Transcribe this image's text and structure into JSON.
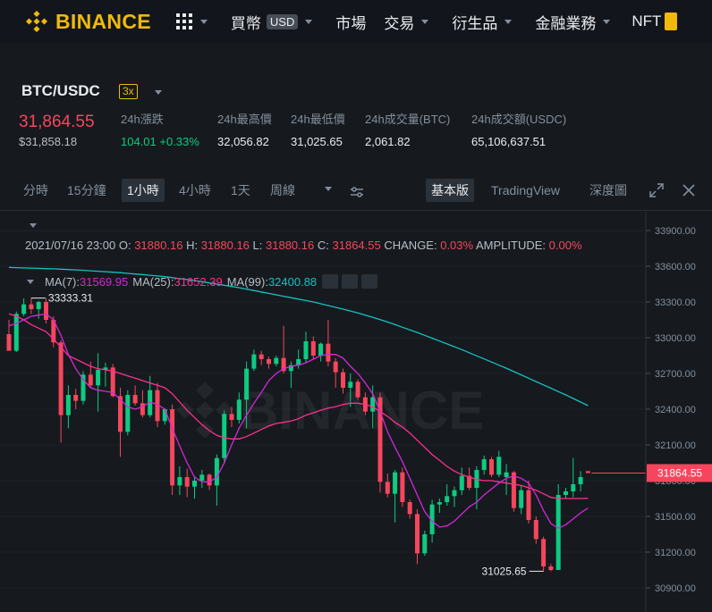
{
  "brand": {
    "name": "BINANCE",
    "color": "#f0b90b"
  },
  "nav": {
    "grid_icon": "grid-icon",
    "items": [
      {
        "label": "買幣",
        "badge": "USD"
      },
      {
        "label": "市場"
      },
      {
        "label": "交易"
      },
      {
        "label": "衍生品"
      },
      {
        "label": "金融業務"
      },
      {
        "label": "NFT"
      }
    ]
  },
  "pair": {
    "symbol": "BTC/USDC",
    "leverage": "3x",
    "last_price": "31,864.55",
    "last_price_usd": "$31,858.18",
    "stats": [
      {
        "label": "24h漲跌",
        "value": "104.01 +0.33%"
      },
      {
        "label": "24h最高價",
        "value": "32,056.82"
      },
      {
        "label": "24h最低價",
        "value": "31,025.65"
      },
      {
        "label": "24h成交量(BTC)",
        "value": "2,061.82"
      },
      {
        "label": "24h成交額(USDC)",
        "value": "65,106,637.51"
      }
    ]
  },
  "toolbar": {
    "intervals": [
      "分時",
      "15分鐘",
      "1小時",
      "4小時",
      "1天",
      "周線"
    ],
    "active_interval": "1小時",
    "views": [
      "基本版",
      "TradingView",
      "深度圖"
    ],
    "active_view": "基本版"
  },
  "ohlc": {
    "date": "2021/07/16 23:00",
    "o_label": "O:",
    "o": "31880.16",
    "h_label": "H:",
    "h": "31880.16",
    "l_label": "L:",
    "l": "31880.16",
    "c_label": "C:",
    "c": "31864.55",
    "change_label": "CHANGE:",
    "change": "0.03%",
    "amp_label": "AMPLITUDE:",
    "amplitude": "0.00%"
  },
  "ma": {
    "ma7_label": "MA(7):",
    "ma7": "31569.95",
    "ma25_label": "MA(25):",
    "ma25": "31652.39",
    "ma99_label": "MA(99):",
    "ma99": "32400.88"
  },
  "colors": {
    "up": "#0ecb81",
    "down": "#f6465d",
    "ma7": "#d427d9",
    "ma25": "#ff2f8f",
    "ma99": "#14c2c2",
    "bg": "#161a1e"
  },
  "chart_data": {
    "type": "candlestick",
    "y_ticks": [
      "33900.00",
      "33600.00",
      "33300.00",
      "33000.00",
      "32700.00",
      "32400.00",
      "32100.00",
      "31800.00",
      "31500.00",
      "31200.00",
      "30900.00"
    ],
    "ylim": [
      30800,
      34000
    ],
    "current_price_label": "31864.55",
    "high_marker": "33333.31",
    "low_marker": "31025.65",
    "watermark": "BINANCE",
    "candles_ohlc": [
      [
        33030,
        33150,
        32890,
        32890
      ],
      [
        32890,
        33220,
        32880,
        33200
      ],
      [
        33200,
        33330,
        33180,
        33280
      ],
      [
        33280,
        33333,
        33200,
        33240
      ],
      [
        33240,
        33310,
        33160,
        33300
      ],
      [
        33300,
        33330,
        33120,
        33150
      ],
      [
        33150,
        33180,
        32920,
        32960
      ],
      [
        32960,
        32980,
        32120,
        32350
      ],
      [
        32350,
        32600,
        32240,
        32520
      ],
      [
        32520,
        32570,
        32400,
        32470
      ],
      [
        32470,
        32720,
        32440,
        32690
      ],
      [
        32690,
        32800,
        32580,
        32600
      ],
      [
        32600,
        32870,
        32380,
        32730
      ],
      [
        32730,
        32790,
        32590,
        32750
      ],
      [
        32750,
        32780,
        32500,
        32510
      ],
      [
        32510,
        32580,
        32000,
        32210
      ],
      [
        32210,
        32560,
        32180,
        32520
      ],
      [
        32520,
        32600,
        32430,
        32450
      ],
      [
        32450,
        32560,
        32330,
        32350
      ],
      [
        32350,
        32680,
        32330,
        32560
      ],
      [
        32560,
        32620,
        32250,
        32300
      ],
      [
        32300,
        32410,
        32270,
        32400
      ],
      [
        32400,
        32440,
        31680,
        31760
      ],
      [
        31760,
        31920,
        31680,
        31830
      ],
      [
        31830,
        31900,
        31660,
        31750
      ],
      [
        31750,
        31840,
        31650,
        31800
      ],
      [
        31800,
        31890,
        31740,
        31850
      ],
      [
        31850,
        31860,
        31720,
        31760
      ],
      [
        31760,
        32020,
        31590,
        31990
      ],
      [
        31990,
        32390,
        31940,
        32360
      ],
      [
        32360,
        32420,
        32250,
        32310
      ],
      [
        32310,
        32540,
        32280,
        32480
      ],
      [
        32480,
        32800,
        32240,
        32740
      ],
      [
        32740,
        32900,
        32720,
        32860
      ],
      [
        32860,
        32890,
        32770,
        32820
      ],
      [
        32820,
        32840,
        32740,
        32780
      ],
      [
        32780,
        32850,
        32760,
        32830
      ],
      [
        32830,
        33100,
        32700,
        32720
      ],
      [
        32720,
        32800,
        32580,
        32770
      ],
      [
        32770,
        32900,
        32740,
        32820
      ],
      [
        32820,
        33050,
        32790,
        32970
      ],
      [
        32970,
        33010,
        32820,
        32850
      ],
      [
        32850,
        32960,
        32800,
        32950
      ],
      [
        32950,
        33150,
        32760,
        32800
      ],
      [
        32800,
        32830,
        32580,
        32710
      ],
      [
        32710,
        32740,
        32530,
        32580
      ],
      [
        32580,
        32700,
        32420,
        32630
      ],
      [
        32630,
        32650,
        32480,
        32500
      ],
      [
        32500,
        32540,
        32350,
        32380
      ],
      [
        32380,
        32600,
        32240,
        32500
      ],
      [
        32500,
        32540,
        31700,
        31790
      ],
      [
        31790,
        31860,
        31660,
        31690
      ],
      [
        31690,
        31890,
        31450,
        31870
      ],
      [
        31870,
        31910,
        31580,
        31620
      ],
      [
        31620,
        31640,
        31480,
        31520
      ],
      [
        31520,
        31560,
        31100,
        31190
      ],
      [
        31190,
        31380,
        31170,
        31350
      ],
      [
        31350,
        31640,
        31280,
        31600
      ],
      [
        31600,
        31650,
        31530,
        31620
      ],
      [
        31620,
        31770,
        31590,
        31670
      ],
      [
        31670,
        31750,
        31580,
        31720
      ],
      [
        31720,
        31910,
        31680,
        31840
      ],
      [
        31840,
        31910,
        31720,
        31740
      ],
      [
        31740,
        31920,
        31560,
        31890
      ],
      [
        31890,
        32010,
        31850,
        31980
      ],
      [
        31980,
        32000,
        31830,
        31850
      ],
      [
        31850,
        32050,
        31830,
        32000
      ],
      [
        31830,
        31940,
        31680,
        31870
      ],
      [
        31870,
        31880,
        31540,
        31570
      ],
      [
        31570,
        31760,
        31520,
        31720
      ],
      [
        31720,
        31800,
        31440,
        31470
      ],
      [
        31470,
        31500,
        31270,
        31310
      ],
      [
        31310,
        31330,
        31040,
        31080
      ],
      [
        31080,
        31100,
        31040,
        31050
      ],
      [
        31050,
        31770,
        31050,
        31680
      ],
      [
        31680,
        31740,
        31650,
        31710
      ],
      [
        31710,
        31990,
        31660,
        31770
      ],
      [
        31770,
        31880,
        31710,
        31830
      ],
      [
        31880,
        31880,
        31880,
        31864
      ]
    ],
    "ma7": [
      33100,
      33120,
      33150,
      33180,
      33190,
      33200,
      33150,
      33020,
      32860,
      32740,
      32650,
      32580,
      32560,
      32550,
      32540,
      32480,
      32420,
      32400,
      32420,
      32460,
      32440,
      32400,
      32240,
      32090,
      31950,
      31830,
      31790,
      31790,
      31830,
      31950,
      32100,
      32240,
      32350,
      32450,
      32540,
      32640,
      32700,
      32740,
      32760,
      32770,
      32790,
      32820,
      32850,
      32860,
      32860,
      32830,
      32760,
      32700,
      32620,
      32530,
      32380,
      32210,
      32080,
      31960,
      31820,
      31680,
      31540,
      31460,
      31410,
      31420,
      31460,
      31520,
      31580,
      31620,
      31680,
      31730,
      31780,
      31820,
      31840,
      31820,
      31780,
      31680,
      31550,
      31440,
      31400,
      31430,
      31480,
      31530,
      31570
    ],
    "ma25": [
      33200,
      33180,
      33150,
      33110,
      33080,
      33050,
      32990,
      32920,
      32850,
      32820,
      32790,
      32760,
      32740,
      32730,
      32720,
      32700,
      32680,
      32660,
      32640,
      32620,
      32600,
      32580,
      32530,
      32460,
      32390,
      32330,
      32270,
      32220,
      32180,
      32160,
      32150,
      32150,
      32170,
      32200,
      32230,
      32260,
      32280,
      32290,
      32300,
      32320,
      32350,
      32370,
      32390,
      32410,
      32420,
      32440,
      32450,
      32450,
      32440,
      32420,
      32380,
      32340,
      32290,
      32250,
      32200,
      32140,
      32080,
      32020,
      31970,
      31920,
      31880,
      31850,
      31830,
      31810,
      31800,
      31800,
      31790,
      31780,
      31770,
      31760,
      31740,
      31720,
      31690,
      31660,
      31650,
      31650,
      31650,
      31650,
      31652
    ],
    "ma99": [
      33590,
      33588,
      33586,
      33584,
      33582,
      33580,
      33578,
      33575,
      33572,
      33569,
      33566,
      33562,
      33558,
      33554,
      33550,
      33546,
      33540,
      33535,
      33530,
      33524,
      33518,
      33512,
      33504,
      33496,
      33488,
      33480,
      33470,
      33460,
      33450,
      33440,
      33430,
      33420,
      33408,
      33396,
      33384,
      33372,
      33360,
      33348,
      33336,
      33324,
      33312,
      33300,
      33285,
      33270,
      33255,
      33240,
      33224,
      33208,
      33190,
      33172,
      33152,
      33132,
      33110,
      33088,
      33066,
      33044,
      33020,
      32996,
      32972,
      32948,
      32924,
      32900,
      32874,
      32848,
      32822,
      32796,
      32770,
      32744,
      32716,
      32688,
      32660,
      32632,
      32604,
      32576,
      32548,
      32520,
      32490,
      32460,
      32430
    ]
  }
}
